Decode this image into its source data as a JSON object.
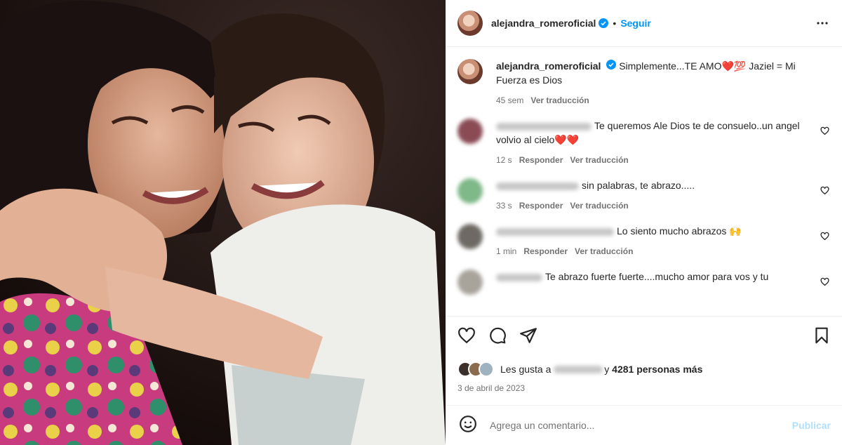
{
  "post": {
    "username": "alejandra_romeroficial",
    "follow_label": "Seguir",
    "more_icon": "more-horizontal-icon"
  },
  "caption": {
    "username": "alejandra_romeroficial",
    "text": "Simplemente...TE AMO❤️💯 Jaziel = Mi Fuerza es Dios",
    "time": "45 sem",
    "translate_label": "Ver traducción"
  },
  "comments": [
    {
      "username": "mercedesbaamonde",
      "text": "Te queremos Ale Dios te de consuelo..un angel volvio al cielo❤️❤️",
      "time": "12 s",
      "reply_label": "Responder",
      "translate_label": "Ver traducción",
      "avatar_color": "#8a4b55"
    },
    {
      "username": "andrecrillasd",
      "text": "sin palabras, te abrazo.....",
      "time": "33 s",
      "reply_label": "Responder",
      "translate_label": "Ver traducción",
      "avatar_color": "#7fb889"
    },
    {
      "username": "patriciasilvaromero2023",
      "text": "Lo siento mucho abrazos 🙌",
      "time": "1 min",
      "reply_label": "Responder",
      "translate_label": "Ver traducción",
      "avatar_color": "#6e6a63"
    },
    {
      "username": "natalio71",
      "text": "Te abrazo fuerte fuerte....mucho amor para vos y tu",
      "avatar_color": "#a8a39b"
    }
  ],
  "likes": {
    "prefix": "Les gusta a",
    "liker": "pabloarnoldi",
    "connector": "y",
    "count_text": "4281 personas más"
  },
  "date": "3 de abril de 2023",
  "add_comment": {
    "placeholder": "Agrega un comentario...",
    "publish_label": "Publicar"
  },
  "colors": {
    "accent": "#0095f6",
    "publish_disabled": "#b2dffc",
    "muted": "#737373"
  }
}
